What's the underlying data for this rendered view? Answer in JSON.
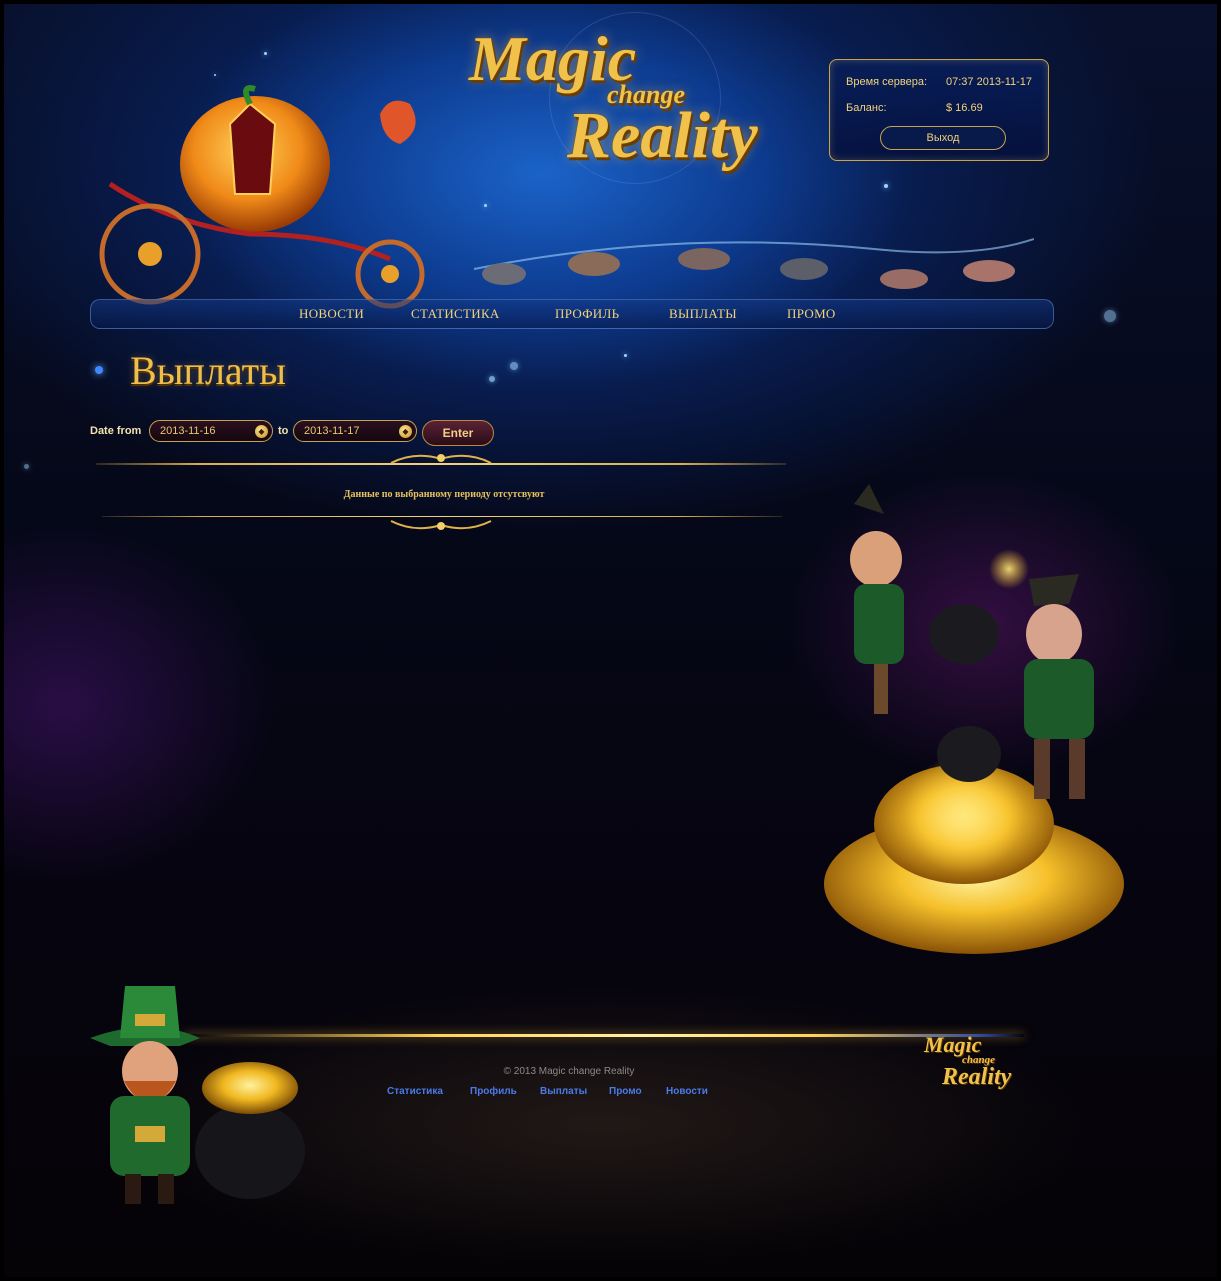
{
  "logo": {
    "word1": "Magic",
    "word2": "change",
    "word3": "Reality"
  },
  "info": {
    "server_time_label": "Время сервера:",
    "server_time_value": "07:37 2013-11-17",
    "balance_label": "Баланс:",
    "balance_value": "$ 16.69",
    "logout_label": "Выход"
  },
  "nav": [
    "НОВОСТИ",
    "СТАТИСТИКА",
    "ПРОФИЛЬ",
    "ВЫПЛАТЫ",
    "ПРОМО"
  ],
  "page_title": "Выплаты",
  "filter": {
    "date_from_label": "Date from",
    "date_from_value": "2013-11-16",
    "to_label": "to",
    "date_to_value": "2013-11-17",
    "enter_label": "Enter"
  },
  "empty_message": "Данные по выбранному периоду отсутсвуют",
  "footer": {
    "copyright": "© 2013 Magic change Reality",
    "links": [
      "Статистика",
      "Профиль",
      "Выплаты",
      "Промо",
      "Новости"
    ],
    "logo_word1": "Magic",
    "logo_word2": "change",
    "logo_word3": "Reality"
  },
  "colors": {
    "gold": "#efbf4a",
    "blue": "#1b63c9",
    "footer_link": "#4a7be8"
  },
  "icons": [
    "calendar-icon",
    "pumpkin-carriage-illustration",
    "rats-illustration",
    "leprechaun-illustration",
    "gold-pile-illustration"
  ]
}
